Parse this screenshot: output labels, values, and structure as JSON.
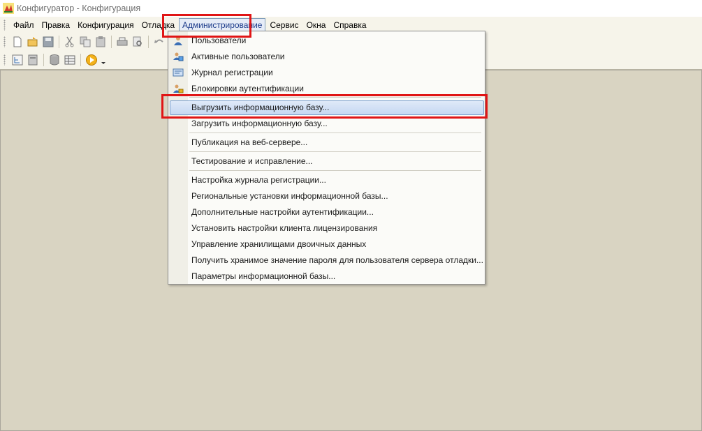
{
  "window": {
    "title": "Конфигуратор - Конфигурация",
    "icon": "app-1c-icon"
  },
  "menubar": {
    "items": [
      {
        "label": "Файл",
        "name": "menu-file"
      },
      {
        "label": "Правка",
        "name": "menu-edit"
      },
      {
        "label": "Конфигурация",
        "name": "menu-configuration"
      },
      {
        "label": "Отладка",
        "name": "menu-debug"
      },
      {
        "label": "Администрирование",
        "name": "menu-administration",
        "active": true
      },
      {
        "label": "Сервис",
        "name": "menu-service"
      },
      {
        "label": "Окна",
        "name": "menu-windows"
      },
      {
        "label": "Справка",
        "name": "menu-help"
      }
    ]
  },
  "toolbar1": {
    "buttons": [
      "new-document-icon",
      "open-icon",
      "save-icon",
      "separator",
      "cut-icon",
      "copy-icon",
      "paste-icon",
      "separator",
      "print-icon",
      "print-preview-icon",
      "separator",
      "undo-icon",
      "redo-icon"
    ]
  },
  "toolbar2": {
    "buttons": [
      "tree-icon",
      "module-icon",
      "separator",
      "database-icon",
      "table-icon",
      "separator",
      "run-debug-icon",
      "dropdown-arrow-icon"
    ]
  },
  "admin_menu": {
    "items": [
      {
        "type": "item",
        "label": "Пользователи",
        "icon": "users-icon"
      },
      {
        "type": "item",
        "label": "Активные пользователи",
        "icon": "active-users-icon"
      },
      {
        "type": "item",
        "label": "Журнал регистрации",
        "icon": "event-log-icon"
      },
      {
        "type": "item",
        "label": "Блокировки аутентификации",
        "icon": "auth-lock-icon"
      },
      {
        "type": "separator"
      },
      {
        "type": "item",
        "label": "Выгрузить информационную базу...",
        "highlighted": true
      },
      {
        "type": "item",
        "label": "Загрузить информационную базу..."
      },
      {
        "type": "separator"
      },
      {
        "type": "item",
        "label": "Публикация на веб-сервере..."
      },
      {
        "type": "separator"
      },
      {
        "type": "item",
        "label": "Тестирование и исправление..."
      },
      {
        "type": "separator"
      },
      {
        "type": "item",
        "label": "Настройка журнала регистрации..."
      },
      {
        "type": "item",
        "label": "Региональные установки информационной базы..."
      },
      {
        "type": "item",
        "label": "Дополнительные настройки аутентификации..."
      },
      {
        "type": "item",
        "label": "Установить настройки клиента лицензирования"
      },
      {
        "type": "item",
        "label": "Управление хранилищами двоичных данных"
      },
      {
        "type": "item",
        "label": "Получить хранимое значение пароля для пользователя сервера отладки..."
      },
      {
        "type": "item",
        "label": "Параметры информационной базы..."
      }
    ]
  },
  "annotations": {
    "color": "#e01515"
  }
}
